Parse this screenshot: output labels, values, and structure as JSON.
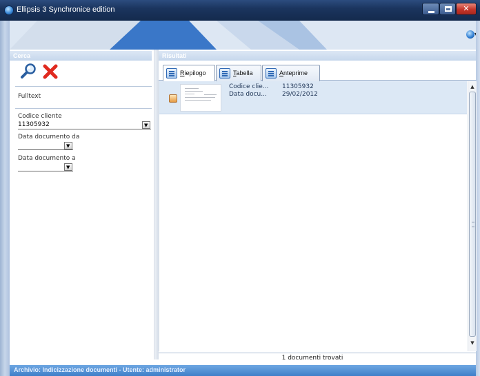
{
  "window": {
    "title": "Ellipsis 3 Synchronice edition"
  },
  "cerca": {
    "title": "Cerca",
    "search_icon": "magnifier-icon",
    "clear_icon": "red-x-icon",
    "fulltext_label": "Fulltext",
    "codice_cliente": {
      "label": "Codice cliente",
      "value": "11305932"
    },
    "data_da": {
      "label": "Data documento da",
      "value": ""
    },
    "data_a": {
      "label": "Data documento a",
      "value": ""
    }
  },
  "risultati": {
    "title": "Risultati",
    "tabs": [
      {
        "prefix": "",
        "accel": "R",
        "rest": "iepilogo",
        "active": true
      },
      {
        "prefix": "",
        "accel": "T",
        "rest": "abella",
        "active": false
      },
      {
        "prefix": "",
        "accel": "A",
        "rest": "nteprime",
        "active": false
      }
    ],
    "items": [
      {
        "fields": [
          {
            "key": "Codice clie...",
            "value": "11305932"
          },
          {
            "key": "Data docu...",
            "value": "29/02/2012"
          }
        ]
      }
    ],
    "status": "1 documenti trovati"
  },
  "bottom_bar": {
    "text": "Archivio: Indicizzazione documenti - Utente: administrator"
  },
  "colors": {
    "accent": "#3f7fc9",
    "panel_header": "#c6d7ec",
    "selection": "#dce8f5",
    "close": "#c4352a"
  }
}
